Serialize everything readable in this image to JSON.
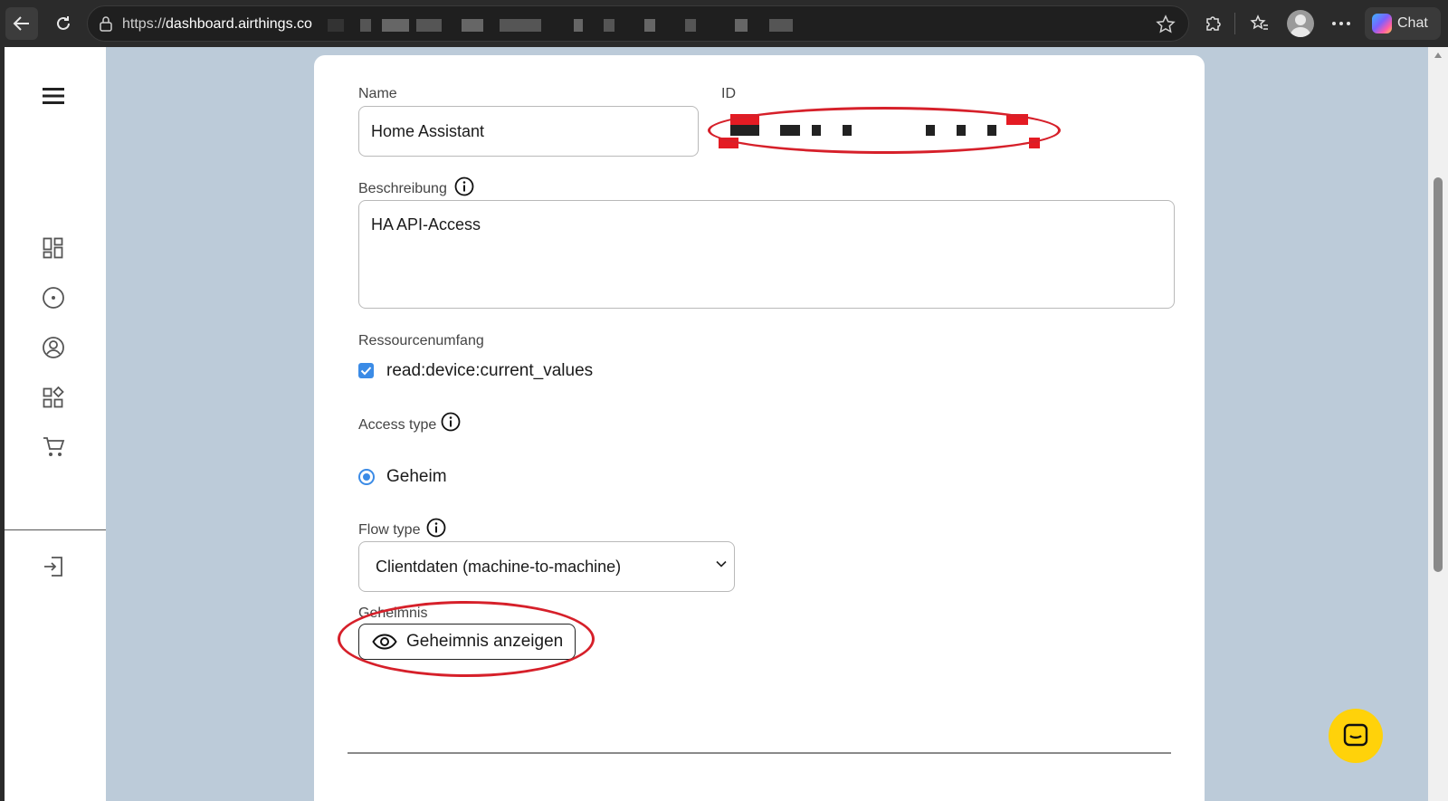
{
  "browser": {
    "url_prefix": "https://",
    "url_host": "dashboard.airthings.co",
    "chat_label": "Chat"
  },
  "icons": {
    "back": "arrow-left-icon",
    "reload": "reload-icon",
    "lock": "lock-icon",
    "favorite": "star-icon",
    "extensions": "puzzle-icon",
    "favorites": "favorites-star-list-icon",
    "profile": "profile-icon",
    "more": "more-icon",
    "copilot": "copilot-icon",
    "menu": "hamburger-menu-icon",
    "dashboard": "dashboard-grid-icon",
    "devices": "device-circle-icon",
    "account": "account-circle-icon",
    "integrations": "widgets-icon",
    "shop": "shopping-cart-icon",
    "logout": "logout-icon",
    "info": "info-icon",
    "eye": "eye-icon",
    "help": "chat-help-icon"
  },
  "colors": {
    "page_background": "#bccbd9",
    "accent": "#3b8be6",
    "annotation": "#d6202a",
    "help_button": "#ffd20a"
  },
  "form": {
    "name_label": "Name",
    "name_value": "Home Assistant",
    "id_label": "ID",
    "description_label": "Beschreibung",
    "description_value": "HA API-Access",
    "scope_label": "Ressourcenumfang",
    "scope_option": "read:device:current_values",
    "scope_checked": true,
    "access_type_label": "Access type",
    "access_type_option": "Geheim",
    "access_type_selected": true,
    "flow_type_label": "Flow type",
    "flow_type_value": "Clientdaten (machine-to-machine)",
    "secret_label": "Geheimnis",
    "show_secret_button": "Geheimnis anzeigen"
  }
}
